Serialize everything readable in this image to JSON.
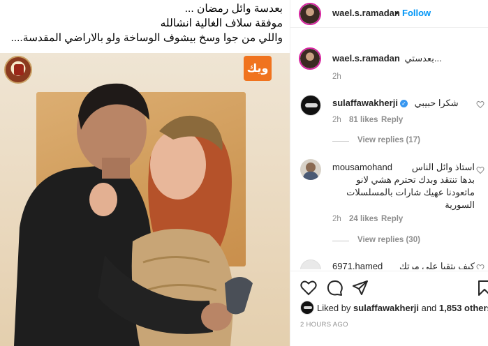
{
  "caption": {
    "line1": "بعدسة وائل رمضان ...",
    "line2": "موفقة سلاف الغالية انشالله",
    "line3": "واللي من جوا وسخ  بيشوف الوساخة ولو بالاراضي المقدسة...."
  },
  "poster": {
    "channel_logo_text": "ويك"
  },
  "header": {
    "username": "wael.s.ramadan",
    "separator": "•",
    "follow_label": "Follow"
  },
  "owner_caption": {
    "username": "wael.s.ramadan",
    "text": "بعدستي...",
    "time": "2h"
  },
  "comments": [
    {
      "username": "sulaffawakherji",
      "verified": true,
      "text": "شكرا حبيبي",
      "time": "2h",
      "likes": "81 likes",
      "reply_label": "Reply",
      "view_replies": "View replies (17)"
    },
    {
      "username": "mousamohand",
      "verified": false,
      "text_lines": [
        "استاذ وائل الناس",
        "بدها تنتقد وبدك تحترم هشي لانو",
        "ماتعودنا عهيك شارات بالمسلسلات",
        "السورية"
      ],
      "time": "2h",
      "likes": "24 likes",
      "reply_label": "Reply",
      "view_replies": "View replies (30)"
    },
    {
      "username": "6971.hamed",
      "verified": false,
      "text": "كيف بتقبا على مرتك"
    }
  ],
  "footer": {
    "liked_by_prefix": "Liked by ",
    "liked_by_user": "sulaffawakherji",
    "liked_by_and": " and ",
    "liked_by_count": "1,853 others",
    "time_ago": "2 HOURS AGO"
  },
  "icons": {
    "heart": "heart-icon",
    "comment": "comment-icon",
    "share": "share-icon",
    "save": "bookmark-icon",
    "verified": "verified-badge-icon"
  },
  "colors": {
    "follow": "#0095f6",
    "verified": "#3897f0",
    "meta_text": "#8e8e8e",
    "story_ring": "#d6249f"
  }
}
